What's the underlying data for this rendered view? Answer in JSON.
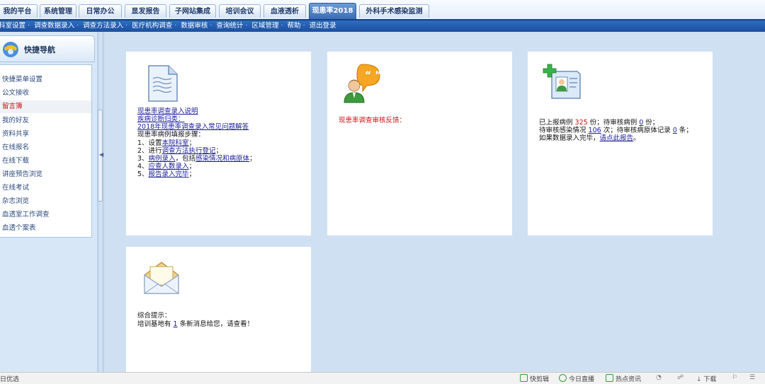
{
  "tabs": [
    {
      "label": "我的平台"
    },
    {
      "label": "系统管理"
    },
    {
      "label": "日常办公"
    },
    {
      "label": "显发报告"
    },
    {
      "label": "子网站集成"
    },
    {
      "label": "培训会议"
    },
    {
      "label": "血液透析"
    },
    {
      "label": "现患率2018",
      "active": true
    },
    {
      "label": "外科手术感染监测"
    }
  ],
  "submenu": [
    "科室设置",
    "调查数据录入",
    "调查方法录入",
    "医疗机构调查",
    "数据审核",
    "查询统计",
    "区域管理",
    "帮助",
    "退出登录"
  ],
  "sidebar": {
    "title": "快捷导航",
    "items": [
      "快捷菜单设置",
      "公文接收",
      "留言簿",
      "我的好友",
      "资料共享",
      "在线报名",
      "在线下载",
      "讲座预告浏览",
      "在线考试",
      "杂志浏览",
      "血透室工作调查",
      "血透个案表"
    ],
    "active_index": 2
  },
  "panel1": {
    "link1": "现患率调查录入说明",
    "link2": "疾病诊断归类：",
    "link3": "2018年现患率调查录入常见问题解答",
    "steps_title": "现患率病例填报步骤：",
    "s1_pre": "1、设置",
    "s1_link": "本院科室",
    "s1_post": "；",
    "s2_pre": "2、进行",
    "s2_link": "调查方法执行登记",
    "s2_post": "；",
    "s3_pre": "3、",
    "s3_link1": "病例录入",
    "s3_mid": "，包括",
    "s3_link2": "感染情况和病原体",
    "s3_post": "；",
    "s4_pre": "4、",
    "s4_link": "应查人数录入",
    "s4_post": "；",
    "s5_pre": "5、",
    "s5_link": "报告录入完毕",
    "s5_post": "；"
  },
  "panel2": {
    "feedback": "现患率调查审核反馈："
  },
  "panel3": {
    "l1_a": "已上报病例 ",
    "reported": "325",
    "l1_b": " 份；待审核病例 ",
    "pending": "0",
    "l1_c": " 份；",
    "l2_a": "待审核感染情况 ",
    "infections": "106",
    "l2_b": " 次；待审核病原体记录 ",
    "pathogens": "0",
    "l2_c": " 条；",
    "l3_a": "如果数据录入完毕，",
    "l3_link": "请点此报告",
    "l3_b": "。"
  },
  "panel4": {
    "hint_title": "综合提示：",
    "msg_a": "培训基地有 ",
    "msg_count": "1",
    "msg_b": " 条新消息给您，请查看！"
  },
  "statusbar": {
    "left": "日优选",
    "items": [
      "快剪辑",
      "今日直播",
      "热点资讯",
      "下载"
    ]
  },
  "colors": {
    "accent": "#1c4f9f",
    "link": "#1a1a99",
    "alert": "#cc1111"
  }
}
